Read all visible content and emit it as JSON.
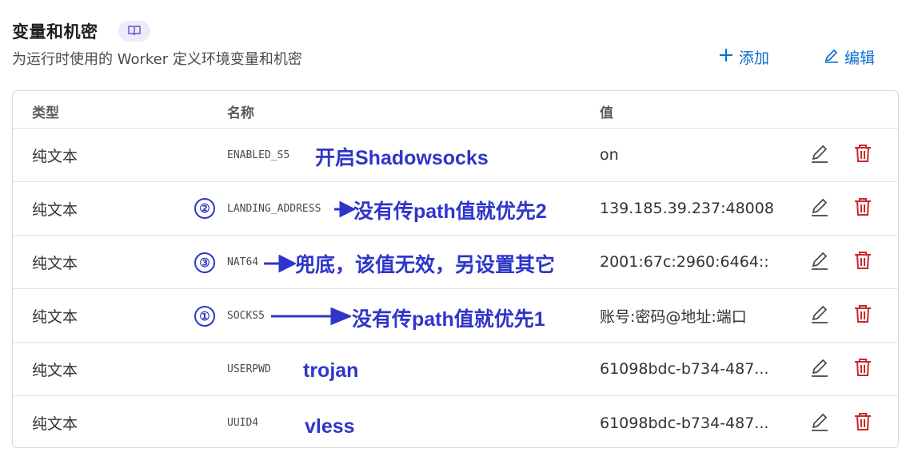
{
  "header": {
    "title": "变量和机密",
    "subtitle": "为运行时使用的 Worker 定义环境变量和机密",
    "add_label": "添加",
    "edit_label": "编辑"
  },
  "table": {
    "columns": [
      "类型",
      "名称",
      "值"
    ],
    "rows": [
      {
        "type": "纯文本",
        "name": "ENABLED_S5",
        "value": "on"
      },
      {
        "type": "纯文本",
        "name": "LANDING_ADDRESS",
        "value": "139.185.39.237:48008"
      },
      {
        "type": "纯文本",
        "name": "NAT64",
        "value": "2001:67c:2960:6464::"
      },
      {
        "type": "纯文本",
        "name": "SOCKS5",
        "value": "账号:密码@地址:端口"
      },
      {
        "type": "纯文本",
        "name": "USERPWD",
        "value": "61098bdc-b734-487..."
      },
      {
        "type": "纯文本",
        "name": "UUID4",
        "value": "61098bdc-b734-487..."
      }
    ]
  },
  "annotations": {
    "enabled_s5": "开启Shadowsocks",
    "landing": "没有传path值就优先2",
    "nat64": "兜底，该值无效，另设置其它",
    "socks5": "没有传path值就优先1",
    "userpwd": "trojan",
    "uuid4": "vless",
    "num_landing": "②",
    "num_nat64": "③",
    "num_socks5": "①"
  },
  "colors": {
    "accent": "#0a6ecd",
    "delete": "#c8282c",
    "annotation": "#2e36c9"
  },
  "icons": [
    "book-icon",
    "plus-icon",
    "pencil-icon",
    "trash-icon",
    "arrow-icon"
  ]
}
